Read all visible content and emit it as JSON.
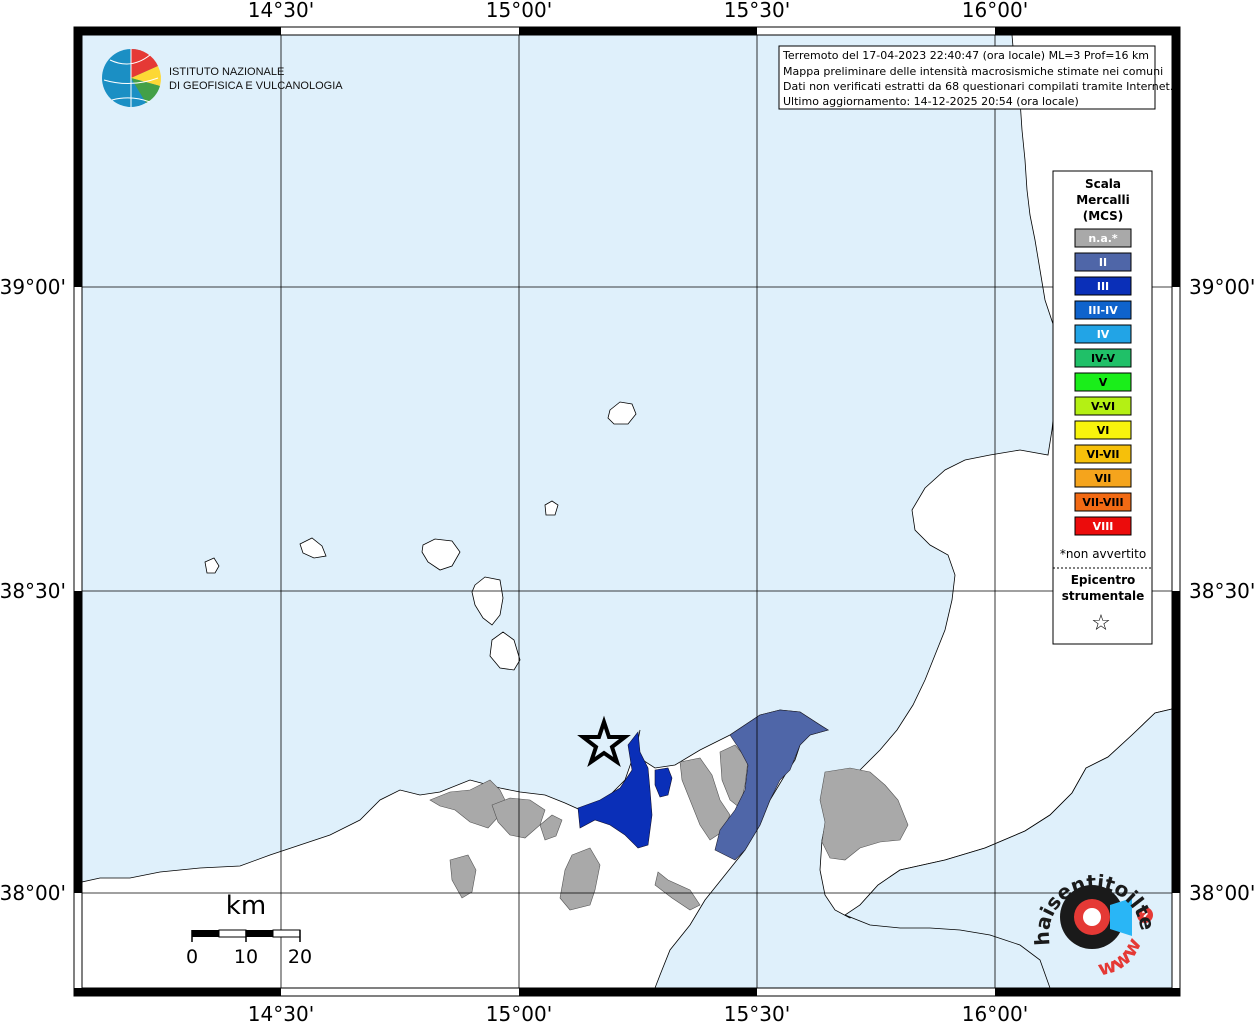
{
  "map": {
    "lon_labels": [
      "14°30'",
      "15°00'",
      "15°30'",
      "16°00'"
    ],
    "lat_labels": [
      "39°00'",
      "38°30'",
      "38°00'"
    ]
  },
  "colors": {
    "sea": "#dff0fb",
    "land": "#ffffff",
    "coast": "#000000",
    "grid": "#000000",
    "star": "#000000"
  },
  "logo": {
    "line1": "ISTITUTO NAZIONALE",
    "line2": "DI GEOFISICA E VULCANOLOGIA"
  },
  "info_box": {
    "line1": "Terremoto del 17-04-2023 22:40:47 (ora locale) ML=3 Prof=16 km",
    "line2": "Mappa preliminare delle intensità macrosismiche stimate nei comuni",
    "line3": "Dati non verificati estratti da 68 questionari compilati tramite Internet.",
    "line4": "Ultimo aggiornamento: 14-12-2025 20:54 (ora locale)"
  },
  "legend": {
    "title1": "Scala",
    "title2": "Mercalli",
    "title3": "(MCS)",
    "classes": [
      {
        "label": "n.a.*",
        "color": "#a9a9a9",
        "text_color": "#ffffff"
      },
      {
        "label": "II",
        "color": "#4f66a8",
        "text_color": "#ffffff"
      },
      {
        "label": "III",
        "color": "#0a2fb8",
        "text_color": "#ffffff"
      },
      {
        "label": "III-IV",
        "color": "#0f63cc",
        "text_color": "#ffffff"
      },
      {
        "label": "IV",
        "color": "#22a4e6",
        "text_color": "#ffffff"
      },
      {
        "label": "IV-V",
        "color": "#20c068",
        "text_color": "#000000"
      },
      {
        "label": "V",
        "color": "#1aee1a",
        "text_color": "#000000"
      },
      {
        "label": "V-VI",
        "color": "#b4f014",
        "text_color": "#000000"
      },
      {
        "label": "VI",
        "color": "#f8f40c",
        "text_color": "#000000"
      },
      {
        "label": "VI-VII",
        "color": "#f6c00a",
        "text_color": "#000000"
      },
      {
        "label": "VII",
        "color": "#f5a41c",
        "text_color": "#000000"
      },
      {
        "label": "VII-VIII",
        "color": "#f26a14",
        "text_color": "#000000"
      },
      {
        "label": "VIII",
        "color": "#ec0c0c",
        "text_color": "#ffffff"
      }
    ],
    "note": "*non avvertito",
    "epicenter1": "Epicentro",
    "epicenter2": "strumentale",
    "star_symbol": "☆"
  },
  "scalebar": {
    "unit": "km",
    "ticks": [
      "0",
      "10",
      "20"
    ]
  },
  "brand": {
    "text": "haisentitoilterremoto.it",
    "url_text": "www.",
    "question": "?"
  }
}
